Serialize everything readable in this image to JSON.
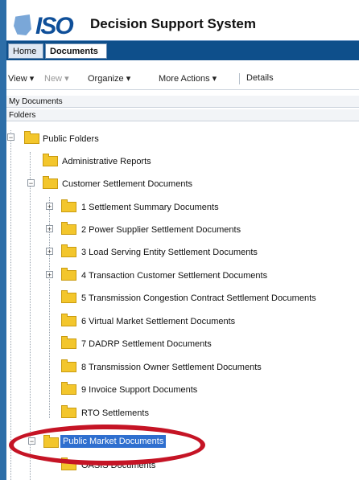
{
  "app": {
    "logo_text": "ISO",
    "title": "Decision Support System"
  },
  "tabs": {
    "home": "Home",
    "documents": "Documents"
  },
  "toolbar": {
    "view": "View",
    "new": "New",
    "organize": "Organize",
    "more_actions": "More Actions",
    "details": "Details",
    "dropdown_glyph": "▾"
  },
  "sections": {
    "my_documents": "My Documents",
    "folders": "Folders"
  },
  "tree": {
    "public_folders": "Public Folders",
    "administrative_reports": "Administrative Reports",
    "customer_settlement_documents": "Customer Settlement Documents",
    "settlement_summary": "1 Settlement Summary Documents",
    "power_supplier": "2 Power Supplier Settlement Documents",
    "load_serving": "3 Load Serving Entity Settlement Documents",
    "transaction_customer": "4 Transaction Customer Settlement Documents",
    "transmission_congestion": "5 Transmission Congestion Contract Settlement Documents",
    "virtual_market": "6 Virtual Market Settlement Documents",
    "dadrp": "7 DADRP Settlement Documents",
    "transmission_owner": "8 Transmission Owner Settlement Documents",
    "invoice_support": "9 Invoice Support Documents",
    "rto": "RTO Settlements",
    "public_market_documents": "Public Market Documents",
    "oasis": "OASIS Documents",
    "plus": "+",
    "minus": "−"
  },
  "colors": {
    "selection": "#2f6fcf",
    "callout": "#c51425",
    "tabbar": "#0e4f8b"
  }
}
